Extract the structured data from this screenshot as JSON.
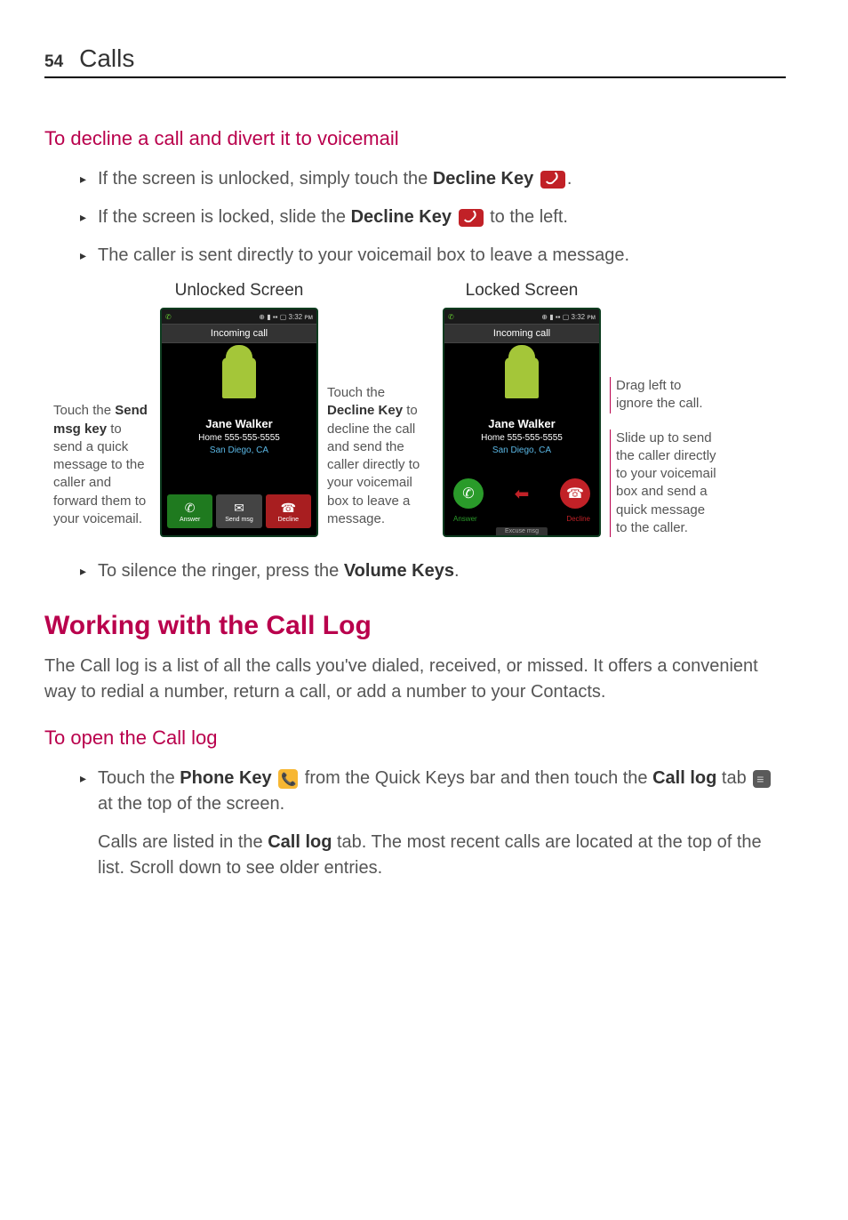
{
  "page": {
    "number": "54",
    "section": "Calls"
  },
  "sec1": {
    "heading": "To decline a call and divert it to voicemail",
    "b1a": "If the screen is unlocked, simply touch the ",
    "b1b": "Decline Key",
    "b1c": ".",
    "b2a": "If the screen is locked, slide the ",
    "b2b": "Decline Key",
    "b2c": " to the left.",
    "b3": "The caller is sent directly to your voicemail box to leave a message."
  },
  "shots": {
    "caption_unlocked": "Unlocked Screen",
    "caption_locked": "Locked Screen",
    "status_time": "3:32",
    "incoming": "Incoming call",
    "caller_name": "Jane Walker",
    "caller_num": "Home 555-555-5555",
    "caller_loc": "San Diego, CA",
    "btn_answer": "Answer",
    "btn_sendmsg": "Send msg",
    "btn_decline": "Decline",
    "excuse": "Excuse msg",
    "annot_left": "Touch the Send msg key to send a quick message to the caller and forward them to your voicemail.",
    "annot_left_bold": "Send msg key",
    "annot_left_pre": "Touch the ",
    "annot_left_post": " to send a quick message to the caller and forward them to your voicemail.",
    "annot_mid_pre": "Touch the ",
    "annot_mid_bold": "Decline Key",
    "annot_mid_post": " to decline the call and send the caller directly to your voicemail box to leave a message.",
    "annot_r1": "Drag left to ignore the call.",
    "annot_r2": "Slide up to send the caller directly to your voicemail box and send a quick message to the caller."
  },
  "sec1_after": {
    "b4a": "To silence the ringer, press the ",
    "b4b": "Volume Keys",
    "b4c": "."
  },
  "sec2": {
    "heading": "Working with the Call Log",
    "para": "The Call log is a list of all the calls you've dialed, received, or missed. It offers a convenient way to redial a number, return a call, or add a number to your Contacts."
  },
  "sec3": {
    "heading": "To open the Call log",
    "b1a": "Touch the ",
    "b1b": "Phone Key",
    "b1c": " from the Quick Keys bar and then touch the ",
    "b1d": "Call log",
    "b1e": " tab ",
    "b1f": " at the top of the screen.",
    "p2a": "Calls are listed in the ",
    "p2b": "Call log",
    "p2c": " tab. The most recent calls are located at the top of the list. Scroll down to see older entries."
  }
}
